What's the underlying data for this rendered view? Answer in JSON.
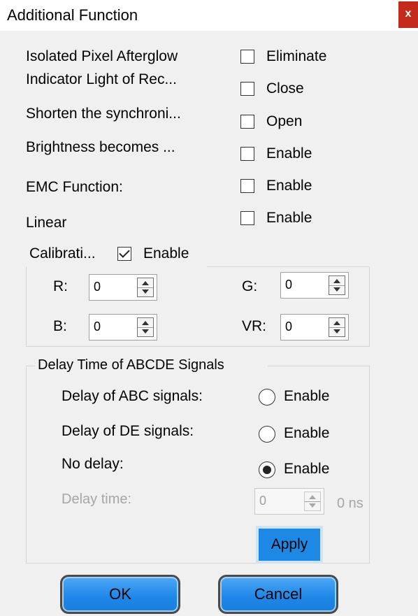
{
  "window": {
    "title": "Additional Function",
    "close_label": "x"
  },
  "options": [
    {
      "label": "Isolated Pixel Afterglow",
      "control_label": "Eliminate",
      "checked": false
    },
    {
      "label": "Indicator Light of Rec...",
      "control_label": "Close",
      "checked": false
    },
    {
      "label": "Shorten the synchroni...",
      "control_label": "Open",
      "checked": false
    },
    {
      "label": "Brightness becomes ...",
      "control_label": "Enable",
      "checked": false
    },
    {
      "label": "EMC Function:",
      "control_label": "Enable",
      "checked": false
    },
    {
      "label": "Linear",
      "control_label": "Enable",
      "checked": false
    }
  ],
  "calibration": {
    "group_label": "Calibrati...",
    "enable_label": "Enable",
    "enabled": true,
    "fields": [
      {
        "label": "R:",
        "value": "0"
      },
      {
        "label": "G:",
        "value": "0"
      },
      {
        "label": "B:",
        "value": "0"
      },
      {
        "label": "VR:",
        "value": "0"
      }
    ]
  },
  "delay": {
    "group_label": "Delay Time of ABCDE Signals",
    "options": [
      {
        "label": "Delay of ABC signals:",
        "radio_label": "Enable",
        "selected": false
      },
      {
        "label": "Delay of DE signals:",
        "radio_label": "Enable",
        "selected": false
      },
      {
        "label": "No delay:",
        "radio_label": "Enable",
        "selected": true
      }
    ],
    "delay_time": {
      "label": "Delay time:",
      "value": "0",
      "unit": "0 ns",
      "disabled": true
    },
    "apply_label": "Apply"
  },
  "buttons": {
    "ok": "OK",
    "cancel": "Cancel"
  },
  "colors": {
    "close": "#c42b1c",
    "apply": "#1e88e5",
    "button": "#1d86e8"
  }
}
